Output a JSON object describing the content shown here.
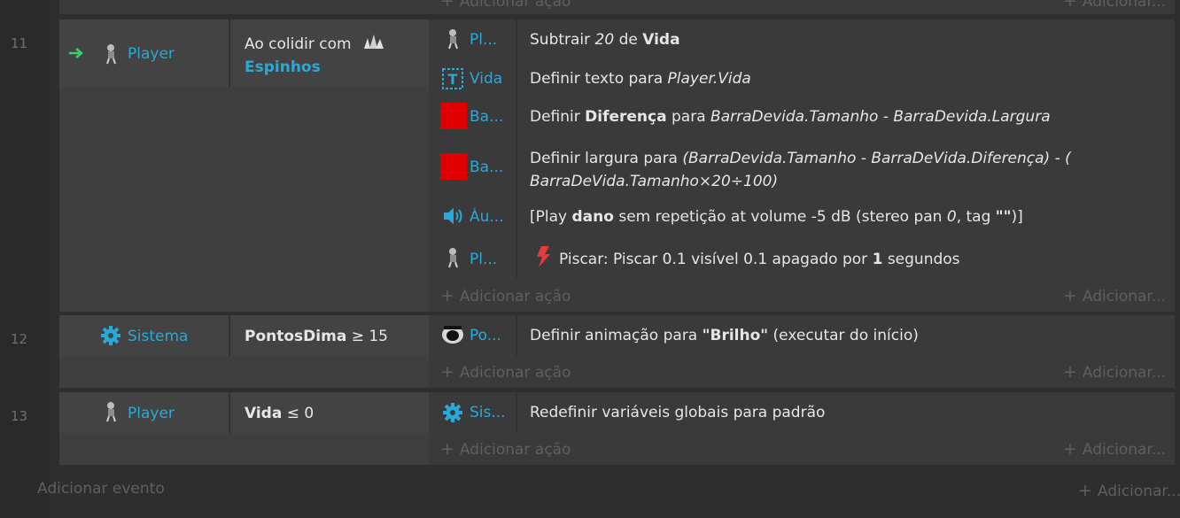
{
  "top_partial": {
    "add_action": "Adicionar ação",
    "add_right": "Adicionar..."
  },
  "events": [
    {
      "number": "11",
      "condition_object": "Player",
      "condition_text": "Ao colidir com",
      "condition_target": "Espinhos",
      "actions": [
        {
          "object": "Pl...",
          "icon": "player-icon"
        },
        {
          "object": "Vida",
          "icon": "text-object-icon"
        },
        {
          "object": "Ba...",
          "icon": "red-sprite-icon"
        },
        {
          "object": "Ba...",
          "icon": "red-sprite-icon"
        },
        {
          "object": "Áu...",
          "icon": "speaker-icon"
        },
        {
          "object": "Pl...",
          "icon": "player-icon"
        }
      ],
      "a1": {
        "t1": "Subtrair ",
        "t2": "20",
        "t3": " de ",
        "t4": "Vida"
      },
      "a2": {
        "t1": "Definir texto para ",
        "t2": "Player.Vida"
      },
      "a3": {
        "t1": "Definir ",
        "t2": "Diferença",
        "t3": " para ",
        "t4": "BarraDevida.Tamanho - BarraDevida.Largura"
      },
      "a4": {
        "t1": "Definir largura para ",
        "t2": "(BarraDevida.Tamanho - BarraDeVida.Diferença) - (",
        "t3": "BarraDeVida.Tamanho×20÷100)"
      },
      "a5": {
        "t1": "[Play ",
        "t2": "dano",
        "t3": " sem repetição at volume -5 dB (stereo pan ",
        "t4": "0",
        "t5": ", tag ",
        "t6": "\"\"",
        "t7": ")]"
      },
      "a6": {
        "t1": "Piscar: Piscar 0.1 visível 0.1 apagado por ",
        "t2": "1",
        "t3": " segundos"
      },
      "add_action": "Adicionar ação",
      "add_right": "Adicionar..."
    },
    {
      "number": "12",
      "condition_object": "Sistema",
      "condition_var": "PontosDima",
      "condition_op": " ≥ 15",
      "action_object": "Po...",
      "a1": {
        "t1": "Definir animação para ",
        "t2": "\"Brilho\"",
        "t3": " (executar do início)"
      },
      "add_action": "Adicionar ação",
      "add_right": "Adicionar..."
    },
    {
      "number": "13",
      "condition_object": "Player",
      "condition_var": "Vida",
      "condition_op": " ≤ 0",
      "action_object": "Sis...",
      "a1": {
        "t1": "Redefinir variáveis globais para padrão"
      },
      "add_action": "Adicionar ação",
      "add_right": "Adicionar..."
    }
  ],
  "footer": {
    "add_event": "Adicionar evento",
    "add_right": "Adicionar..."
  },
  "colors": {
    "accent": "#29a9d8",
    "arrow": "#3ccf6e",
    "sprite": "#e00000",
    "flash": "#e83a3a"
  }
}
